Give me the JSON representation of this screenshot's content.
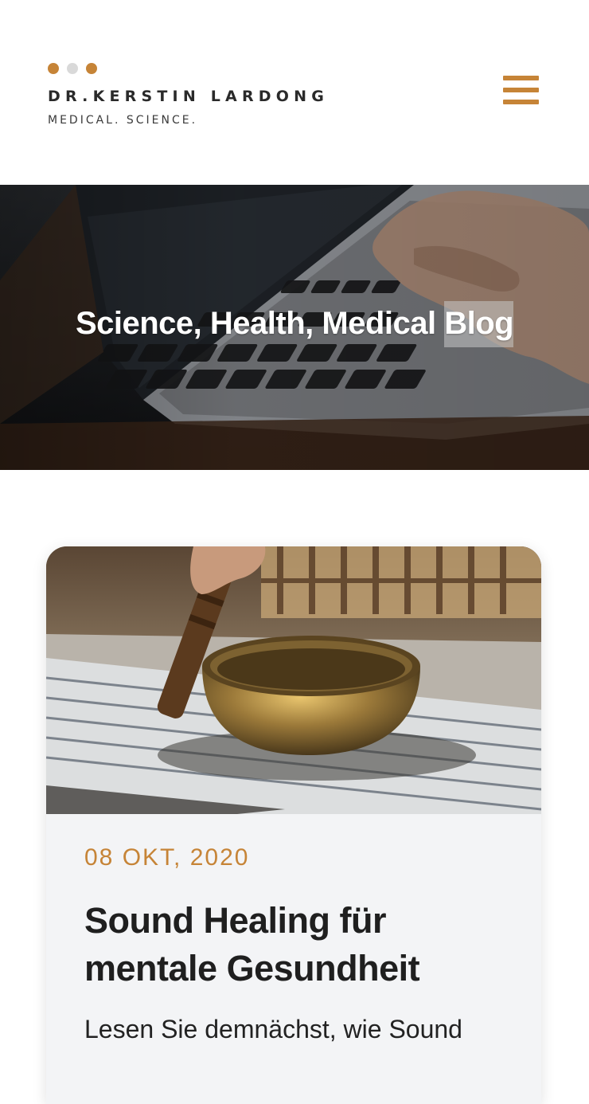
{
  "header": {
    "logo_name": "DR.KERSTIN LARDONG",
    "logo_tagline": "MEDICAL. SCIENCE.",
    "dot_colors": [
      "#c68437",
      "#d9d9d9",
      "#c68437"
    ],
    "menu_icon": "hamburger-icon"
  },
  "hero": {
    "title_main": "Science, Health, Medical ",
    "title_highlight": "Blog"
  },
  "post": {
    "date": "08 OKT, 2020",
    "title": "Sound Healing für mentale Gesundheit",
    "excerpt": "Lesen Sie demnächst, wie Sound"
  },
  "colors": {
    "accent": "#c68437",
    "text_dark": "#1f1f1f",
    "card_bg": "#f3f4f6"
  }
}
